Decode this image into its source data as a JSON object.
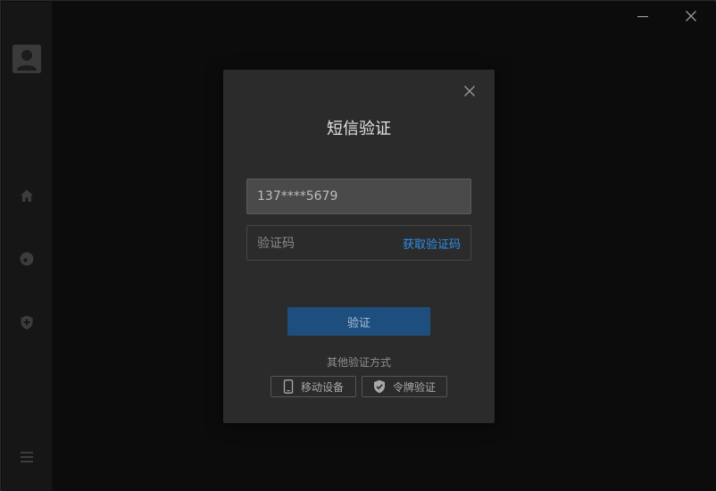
{
  "window": {
    "minimize_icon": "minimize-icon",
    "close_icon": "close-icon"
  },
  "sidebar": {
    "avatar_icon": "user-avatar-icon",
    "items": [
      {
        "name": "home",
        "icon": "home-icon"
      },
      {
        "name": "discover",
        "icon": "disc-icon"
      },
      {
        "name": "security",
        "icon": "shield-plus-icon"
      }
    ],
    "menu_icon": "hamburger-menu-icon"
  },
  "dialog": {
    "title": "短信验证",
    "phone_value": "137****5679",
    "code_placeholder": "验证码",
    "get_code_label": "获取验证码",
    "verify_label": "验证",
    "other_methods_label": "其他验证方式",
    "alt_methods": [
      {
        "label": "移动设备",
        "icon": "mobile-phone-icon"
      },
      {
        "label": "令牌验证",
        "icon": "shield-check-icon"
      }
    ]
  },
  "colors": {
    "accent_link": "#2f8fe8",
    "primary_button": "#1d4e7d",
    "dialog_bg": "#2b2b2b"
  }
}
